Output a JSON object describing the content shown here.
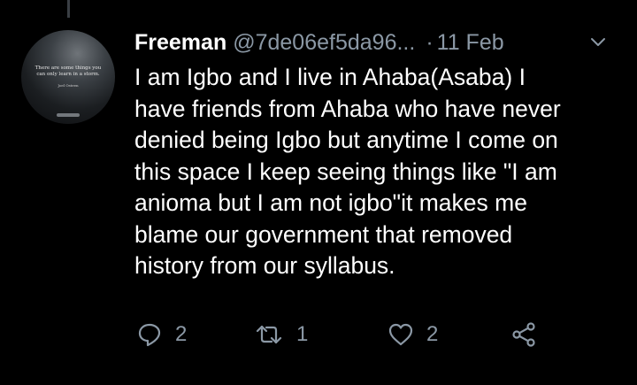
{
  "tweet": {
    "author_name": "Freeman",
    "handle": "@7de06ef5da96...",
    "separator": "·",
    "date": "11 Feb",
    "text": "I am Igbo and I live in Ahaba(Asaba) I\nhave friends from Ahaba who have never\ndenied being Igbo but anytime I come on\nthis space I keep seeing things like \"I am\nanioma but I am not igbo\"it makes me\nblame our government that removed\nhistory from our syllabus."
  },
  "avatar": {
    "quote": "There are some things you can only learn in a storm.",
    "author": "Joel Osteen"
  },
  "actions": {
    "reply": {
      "icon": "reply-icon",
      "count": "2"
    },
    "retweet": {
      "icon": "retweet-icon",
      "count": "1"
    },
    "like": {
      "icon": "heart-icon",
      "count": "2"
    },
    "share": {
      "icon": "share-icon"
    }
  },
  "colors": {
    "background": "#000000",
    "text_primary": "#ffffff",
    "text_secondary": "#8b98a5",
    "thread_line": "#3a3f44"
  }
}
